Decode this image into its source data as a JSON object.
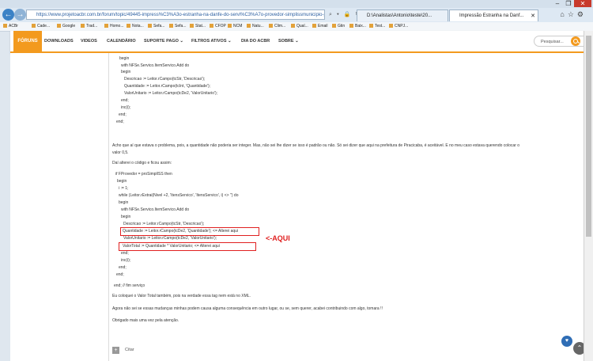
{
  "browser": {
    "url": "https://www.projetoacbr.com.br/forum/topic/49445-impress%C3%A3o-estranha-na-danfe-do-servi%C3%A7o-provedor-simplissmunicipio-piracicaba/",
    "tabs": [
      {
        "label": "D:\\Analistas\\Antonio\\teste\\20..."
      },
      {
        "label": "Impressão Estranha na Danf..."
      }
    ],
    "window_controls": [
      "–",
      "❐",
      "✕"
    ],
    "favorites": [
      "ACBr",
      "Cade...",
      "Google",
      "Trad...",
      "Homo...",
      "Nota...",
      "Sefa...",
      "Sefa...",
      "Stat...",
      "CFOP",
      "NCM",
      "Natu...",
      "Clim...",
      "Qual...",
      "Email",
      "Gtin",
      "Baix...",
      "Test...",
      "CNPJ..."
    ]
  },
  "site_nav": {
    "items": [
      "FÓRUNS",
      "DOWNLOADS",
      "VIDEOS",
      "CALENDÁRIO",
      "SUPORTE PAGO ⌄",
      "FILTROS ATIVOS ⌄",
      "DIA DO ACBR",
      "SOBRE ⌄"
    ],
    "search_placeholder": "Pesquisar..."
  },
  "post": {
    "code1": [
      "begin",
      "with NFSe.Servico.ItemServico.Add do",
      "begin",
      "Descricao := Leitor.rCampo(tcStr, 'Descricao');",
      "Quantidade := Leitor.rCampo(tcInt, 'Quantidade');",
      "ValorUnitario := Leitor.rCampo(tcDe2, 'ValorUnitario');",
      "end;",
      "inc(i);",
      "end;",
      "end;"
    ],
    "para1a": "Acho que aí que estava o problema, pois, a quantidade não poderia ser integer. Mas, não sei lhe dizer se isso é padrão ou não. Só sei dizer que aqui na prefeitura de Piracicaba, é aceitável. E no meu caso estava querendo colocar o",
    "para1b": "valor 0,5.",
    "para2": "Daí alterei o código e ficou assim:",
    "code2": [
      "if FProvedor = proSimplISS then",
      "begin",
      "i := 1;",
      "while (Leitor.rExtrai(Nivel +2, 'ItensServico', 'ItensServico', i) <> '') do",
      "begin",
      "with NFSe.Servico.ItemServico.Add do",
      "begin",
      "Descricao := Leitor.rCampo(tcStr, 'Descricao');",
      "Quantidade := Leitor.rCampo(tcDe2, 'Quantidade');   <= Alterei aqui",
      "ValorUnitario := Leitor.rCampo(tcDe2, 'ValorUnitario');",
      "ValorTotal    := Quantidade * ValorUnitario; <= Alterei aqui",
      "end;",
      "inc(i);",
      "end;",
      "end;",
      "",
      "end; // fim serviço"
    ],
    "annotation": "<-AQUI",
    "para3": "Eu coloquei o Valor Total também, pois na verdade essa tag nem está no XML.",
    "para4": "Agora não sei se essas mudanças minhas podem causa alguma consequência em outro lugar, ou se, sem querer, acabei contribuindo com algo, tomara !!",
    "para5": "Obrigado mais uma vez pela atenção.",
    "quote_label": "Citar"
  },
  "colors": {
    "accent": "#f39a1e",
    "highlight": "#e02020",
    "browser_blue": "#3b82c6"
  }
}
